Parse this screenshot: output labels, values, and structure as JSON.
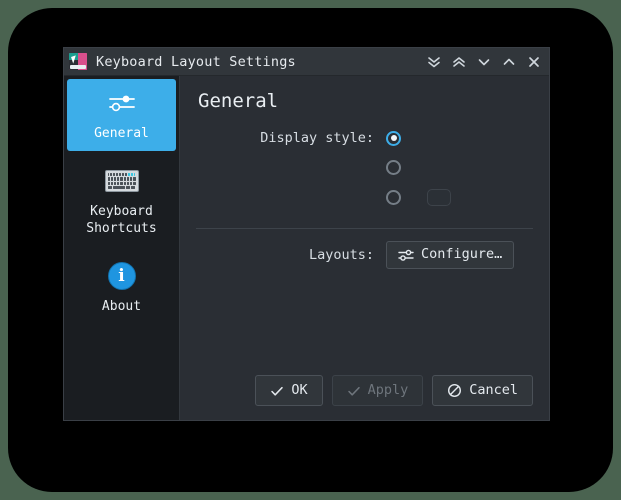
{
  "window": {
    "title": "Keyboard Layout Settings",
    "app_icon": "keyboard-layout-icon",
    "controls": [
      {
        "name": "shade-all-icon",
        "glyph": "double-chevron-down"
      },
      {
        "name": "unshade-all-icon",
        "glyph": "double-chevron-up"
      },
      {
        "name": "minimize-icon",
        "glyph": "chevron-down"
      },
      {
        "name": "maximize-icon",
        "glyph": "chevron-up"
      },
      {
        "name": "close-icon",
        "glyph": "cross"
      }
    ]
  },
  "sidebar": {
    "items": [
      {
        "label": "General",
        "icon": "sliders-icon",
        "selected": true
      },
      {
        "label": "Keyboard\nShortcuts",
        "icon": "keyboard-icon",
        "selected": false
      },
      {
        "label": "About",
        "icon": "info-circle-icon",
        "selected": false
      }
    ]
  },
  "main": {
    "page_title": "General",
    "display_style": {
      "label": "Display style:",
      "options": [
        {
          "label": "",
          "checked": true
        },
        {
          "label": "",
          "checked": false
        },
        {
          "label": "",
          "checked": false
        }
      ]
    },
    "layouts": {
      "label": "Layouts:",
      "configure_button": "Configure…",
      "configure_icon": "sliders-icon"
    }
  },
  "footer": {
    "buttons": [
      {
        "label": "OK",
        "icon": "check-icon",
        "disabled": false
      },
      {
        "label": "Apply",
        "icon": "check-icon",
        "disabled": true
      },
      {
        "label": "Cancel",
        "icon": "cancel-icon",
        "disabled": false
      }
    ]
  },
  "colors": {
    "accent": "#3daee9",
    "window_bg": "#2a2e34",
    "sidebar_bg": "#1a1d21",
    "titlebar_bg": "#31363b",
    "desktop_bg": "#000000",
    "page_bg": "#4a6350"
  }
}
